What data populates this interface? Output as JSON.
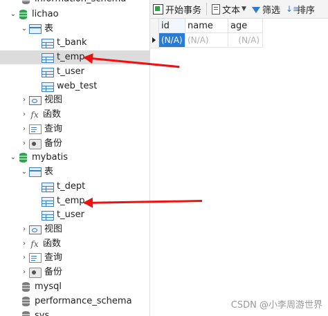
{
  "tree": {
    "top_partial": "information_schema",
    "lichao": {
      "name": "lichao",
      "tables_folder": "表",
      "tables": [
        "t_bank",
        "t_emp",
        "t_user",
        "web_test"
      ],
      "views": "视图",
      "functions": "函数",
      "queries": "查询",
      "backups": "备份"
    },
    "mybatis": {
      "name": "mybatis",
      "tables_folder": "表",
      "tables": [
        "t_dept",
        "t_emp",
        "t_user"
      ],
      "views": "视图",
      "functions": "函数",
      "queries": "查询",
      "backups": "备份"
    },
    "other_dbs": [
      "mysql",
      "performance_schema",
      "sys"
    ],
    "func_icon": "fx"
  },
  "toolbar": {
    "begin_transaction": "开始事务",
    "text": "文本",
    "filter": "筛选",
    "sort": "排序"
  },
  "grid": {
    "columns": [
      "id",
      "name",
      "age"
    ],
    "row": [
      "(N/A)",
      "(N/A)",
      "(N/A)"
    ]
  },
  "watermark": "CSDN @小李周游世界",
  "colors": {
    "arrow": "#ee1111",
    "selection": "#2b7bd0",
    "db_icon": "#2aa34a"
  }
}
